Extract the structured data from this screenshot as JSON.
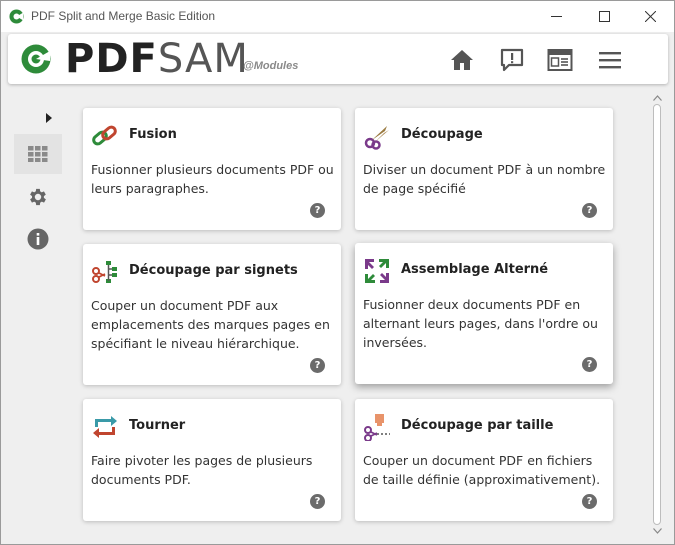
{
  "window": {
    "title": "PDF Split and Merge Basic Edition"
  },
  "header": {
    "logo_pdf": "PDF",
    "logo_sam": "SAM",
    "logo_sub": "@Modules",
    "buttons": [
      "home-icon",
      "feedback-icon",
      "news-icon",
      "menu-icon"
    ]
  },
  "sidebar": {
    "items": [
      "modules-grid-icon",
      "gear-icon",
      "info-icon"
    ]
  },
  "modules": [
    {
      "title": "Fusion",
      "desc": "Fusionner plusieurs documents PDF ou leurs paragraphes.",
      "icon": "chain-link-icon"
    },
    {
      "title": "Découpage",
      "desc": "Diviser un document PDF à un nombre de page spécifié",
      "icon": "scissors-icon"
    },
    {
      "title": "Découpage par signets",
      "desc": "Couper un document PDF aux emplacements des marques pages en spécifiant le niveau hiérarchique.",
      "icon": "bookmark-tree-icon"
    },
    {
      "title": "Assemblage Alterné",
      "desc": "Fusionner deux documents PDF en alternant leurs pages, dans l'ordre ou inversées.",
      "icon": "alternate-mix-icon"
    },
    {
      "title": "Tourner",
      "desc": "Faire pivoter les pages de plusieurs documents PDF.",
      "icon": "rotate-arrows-icon"
    },
    {
      "title": "Découpage par taille",
      "desc": "Couper un document PDF en fichiers de taille définie (approximativement).",
      "icon": "size-scissors-icon"
    }
  ],
  "help_glyph": "?",
  "colors": {
    "accent_green": "#2e8b3a",
    "help_grey": "#6b6b6b",
    "background": "#efefef"
  }
}
